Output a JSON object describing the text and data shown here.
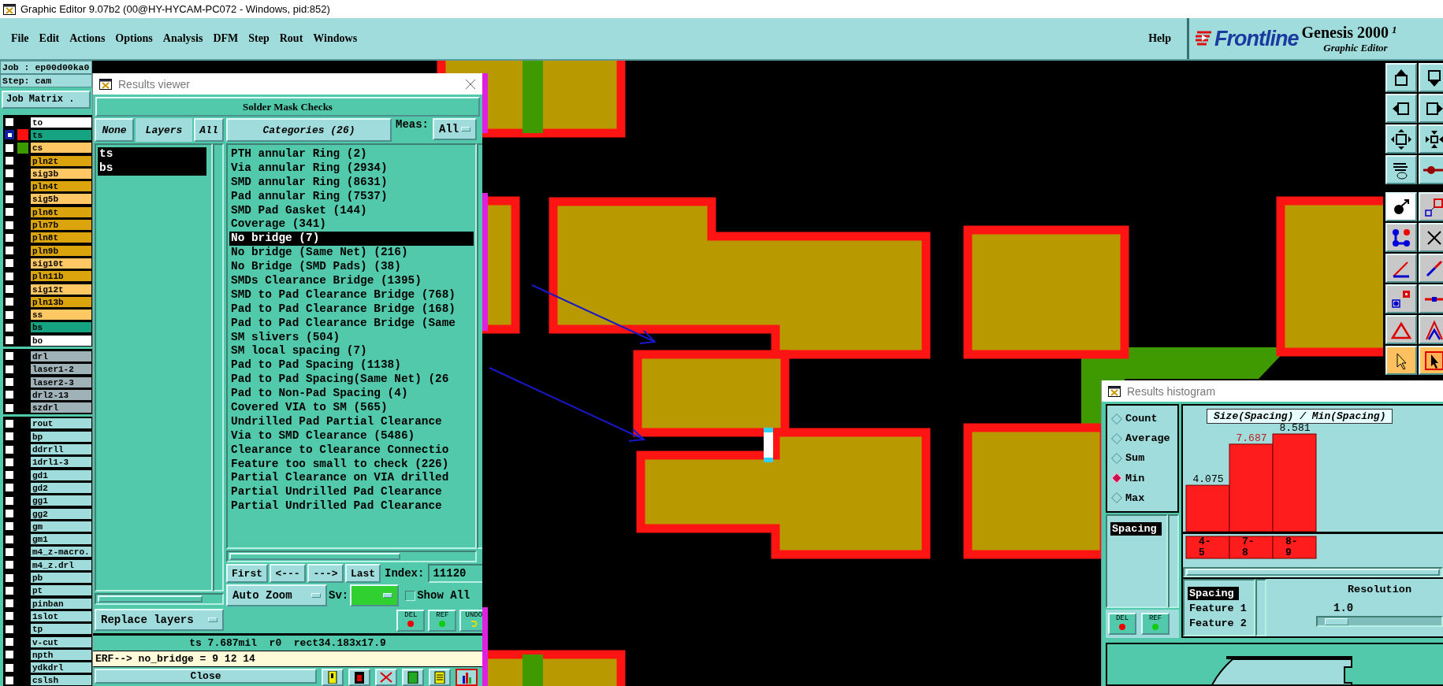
{
  "window": {
    "title": "Graphic Editor 9.07b2 (00@HY-HYCAM-PC072 - Windows, pid:852)"
  },
  "menu": [
    "File",
    "Edit",
    "Actions",
    "Options",
    "Analysis",
    "DFM",
    "Step",
    "Rout",
    "Windows"
  ],
  "help": "Help",
  "logo": {
    "brand": "Frontline",
    "product": "Genesis 2000",
    "version": "1",
    "subtitle": "Graphic Editor"
  },
  "job_panel": {
    "job": "Job : ep00d00ka0",
    "step": "Step: cam",
    "matrix_button": "Job Matrix ."
  },
  "layer_groups": [
    {
      "layers": [
        {
          "name": "to",
          "color": "#ffffff",
          "work": false
        },
        {
          "name": "ts",
          "color": "#16a382",
          "work": true,
          "swatch": {
            "color": "#ff1010"
          }
        },
        {
          "name": "cs",
          "color": "#ffc864",
          "work": false,
          "swatch": {
            "color": "#3a9a00"
          }
        },
        {
          "name": "pln2t",
          "color": "#dba40c",
          "work": false
        },
        {
          "name": "sig3b",
          "color": "#ffc864",
          "work": false
        },
        {
          "name": "pln4t",
          "color": "#dba40c",
          "work": false
        },
        {
          "name": "sig5b",
          "color": "#ffc864",
          "work": false
        },
        {
          "name": "pln6t",
          "color": "#dba40c",
          "work": false
        },
        {
          "name": "pln7b",
          "color": "#dba40c",
          "work": false
        },
        {
          "name": "pln8t",
          "color": "#dba40c",
          "work": false
        },
        {
          "name": "pln9b",
          "color": "#dba40c",
          "work": false
        },
        {
          "name": "sig10t",
          "color": "#ffc864",
          "work": false
        },
        {
          "name": "pln11b",
          "color": "#dba40c",
          "work": false
        },
        {
          "name": "sig12t",
          "color": "#ffc864",
          "work": false
        },
        {
          "name": "pln13b",
          "color": "#dba40c",
          "work": false
        },
        {
          "name": "ss",
          "color": "#ffc864",
          "work": false
        },
        {
          "name": "bs",
          "color": "#16a382",
          "work": false
        },
        {
          "name": "bo",
          "color": "#ffffff",
          "work": false
        }
      ]
    },
    {
      "layers": [
        {
          "name": "drl",
          "color": "#9fb2b8",
          "work": false
        },
        {
          "name": "laser1-2",
          "color": "#9fb2b8",
          "work": false
        },
        {
          "name": "laser2-3",
          "color": "#9fb2b8",
          "work": false
        },
        {
          "name": "drl2-13",
          "color": "#9fb2b8",
          "work": false
        },
        {
          "name": "szdrl",
          "color": "#9fb2b8",
          "work": false
        }
      ]
    },
    {
      "layers": [
        {
          "name": "rout",
          "color": "#a0dcdc",
          "work": false
        },
        {
          "name": "bp",
          "color": "#a0dcdc",
          "work": false
        },
        {
          "name": "ddrrll",
          "color": "#a0dcdc",
          "work": false
        },
        {
          "name": "1drl1-3",
          "color": "#a0dcdc",
          "work": false
        },
        {
          "name": "gd1",
          "color": "#a0dcdc",
          "work": false
        },
        {
          "name": "gd2",
          "color": "#a0dcdc",
          "work": false
        },
        {
          "name": "gg1",
          "color": "#a0dcdc",
          "work": false
        },
        {
          "name": "gg2",
          "color": "#a0dcdc",
          "work": false
        },
        {
          "name": "gm",
          "color": "#a0dcdc",
          "work": false
        },
        {
          "name": "gm1",
          "color": "#a0dcdc",
          "work": false
        },
        {
          "name": "m4_z-macro.",
          "color": "#a0dcdc",
          "work": false
        },
        {
          "name": "m4_z.drl",
          "color": "#a0dcdc",
          "work": false
        },
        {
          "name": "pb",
          "color": "#a0dcdc",
          "work": false
        },
        {
          "name": "pt",
          "color": "#a0dcdc",
          "work": false
        },
        {
          "name": "pinban",
          "color": "#a0dcdc",
          "work": false
        },
        {
          "name": "1slot",
          "color": "#a0dcdc",
          "work": false
        },
        {
          "name": "tp",
          "color": "#a0dcdc",
          "work": false
        },
        {
          "name": "v-cut",
          "color": "#a0dcdc",
          "work": false
        },
        {
          "name": "npth",
          "color": "#a0dcdc",
          "work": false
        },
        {
          "name": "ydkdrl",
          "color": "#a0dcdc",
          "work": false
        },
        {
          "name": "cslsh",
          "color": "#a0dcdc",
          "work": false
        }
      ]
    }
  ],
  "toolbar": [
    {
      "kind": "move-up",
      "selected": false
    },
    {
      "kind": "move-down",
      "selected": false
    },
    {
      "kind": "move-left",
      "selected": false
    },
    {
      "kind": "move-right",
      "selected": false
    },
    {
      "kind": "expand",
      "selected": false
    },
    {
      "kind": "shrink",
      "selected": false
    },
    {
      "kind": "tools",
      "selected": false
    },
    {
      "kind": "snap",
      "selected": false
    },
    {
      "kind": "feature-info",
      "selected": false
    },
    {
      "kind": "edit-shape",
      "selected": false
    },
    {
      "kind": "connect",
      "selected": false
    },
    {
      "kind": "cross",
      "selected": false
    },
    {
      "kind": "measure",
      "selected": false
    },
    {
      "kind": "measure-line",
      "selected": false
    },
    {
      "kind": "measure-pad",
      "selected": false
    },
    {
      "kind": "measure-center",
      "selected": false
    },
    {
      "kind": "triangle",
      "selected": false
    },
    {
      "kind": "triangle-angle",
      "selected": false
    },
    {
      "kind": "pointer",
      "selected": true
    },
    {
      "kind": "pointer-box",
      "selected": true
    }
  ],
  "results_viewer": {
    "title": "Results viewer",
    "header": "Solder Mask Checks",
    "none_button": "None",
    "layers_button": "Layers",
    "all_button": "All",
    "layers": [
      {
        "name": "ts",
        "selected": true
      },
      {
        "name": "bs",
        "selected": true
      }
    ],
    "categories_button": "Categories (26)",
    "meas_label": "Meas:",
    "meas_value": "All",
    "categories": [
      {
        "label": "PTH annular Ring (2)",
        "selected": false
      },
      {
        "label": "Via annular Ring (2934)",
        "selected": false
      },
      {
        "label": "SMD annular Ring (8631)",
        "selected": false
      },
      {
        "label": "Pad annular Ring (7537)",
        "selected": false
      },
      {
        "label": "SMD Pad Gasket (144)",
        "selected": false
      },
      {
        "label": "Coverage (341)",
        "selected": false
      },
      {
        "label": "No bridge (7)",
        "selected": true
      },
      {
        "label": "No bridge (Same Net) (216)",
        "selected": false
      },
      {
        "label": "No Bridge (SMD Pads) (38)",
        "selected": false
      },
      {
        "label": "SMDs Clearance Bridge (1395)",
        "selected": false
      },
      {
        "label": "SMD to Pad Clearance Bridge (768)",
        "selected": false
      },
      {
        "label": "Pad to Pad Clearance Bridge (168)",
        "selected": false
      },
      {
        "label": "Pad to Pad Clearance Bridge (Same",
        "selected": false
      },
      {
        "label": "SM slivers (504)",
        "selected": false
      },
      {
        "label": "SM local spacing (7)",
        "selected": false
      },
      {
        "label": "Pad to Pad Spacing (1138)",
        "selected": false
      },
      {
        "label": "Pad to Pad Spacing(Same Net) (26",
        "selected": false
      },
      {
        "label": "Pad to Non-Pad Spacing (4)",
        "selected": false
      },
      {
        "label": "Covered VIA to SM (565)",
        "selected": false
      },
      {
        "label": "Undrilled Pad Partial Clearance",
        "selected": false
      },
      {
        "label": "Via to SMD Clearance (5486)",
        "selected": false
      },
      {
        "label": "Clearance to Clearance Connectio",
        "selected": false
      },
      {
        "label": "Feature too small to check (226)",
        "selected": false
      },
      {
        "label": "Partial Clearance on VIA drilled",
        "selected": false
      },
      {
        "label": "Partial Undrilled Pad Clearance",
        "selected": false
      },
      {
        "label": "Partial Undrilled Pad Clearance",
        "selected": false
      }
    ],
    "nav": [
      "First",
      "<---",
      "--->",
      "Last"
    ],
    "index_label": "Index:",
    "index_value": "11120",
    "zoom_mode": "Auto Zoom",
    "sv_label": "Sv:",
    "show_all": {
      "label": "Show All",
      "checked": false
    },
    "replace_mode": "Replace layers",
    "edit_buttons": [
      {
        "label": "DEL",
        "kind": "delete"
      },
      {
        "label": "REF",
        "kind": "refresh"
      },
      {
        "label": "UNDO",
        "kind": "undo"
      }
    ],
    "status": "ts 7.687mil  r0  rect34.183x17.9",
    "erf": "ERF--> no_bridge = 9 12 14",
    "close": "Close"
  },
  "histogram": {
    "title": "Results histogram",
    "modes": [
      {
        "label": "Count",
        "selected": false
      },
      {
        "label": "Average",
        "selected": false
      },
      {
        "label": "Sum",
        "selected": false
      },
      {
        "label": "Min",
        "selected": true
      },
      {
        "label": "Max",
        "selected": false
      }
    ],
    "measures": [
      {
        "label": "Spacing",
        "selected": true
      }
    ],
    "buttons": [
      {
        "label": "DEL",
        "kind": "delete"
      },
      {
        "label": "REF",
        "kind": "refresh"
      }
    ],
    "chart_data": {
      "type": "bar",
      "title": "Size(Spacing) / Min(Spacing)",
      "categories": [
        "4-5",
        "7-8",
        "8-9"
      ],
      "values": [
        4.075,
        7.687,
        8.581
      ],
      "data_labels": true
    },
    "fields": [
      {
        "label": "Spacing",
        "selected": true
      },
      {
        "label": "Feature 1",
        "selected": false
      },
      {
        "label": "Feature 2",
        "selected": false
      }
    ],
    "resolution_label": "Resolution",
    "resolution_value": "1.0",
    "resolution": {
      "level": 0.06
    }
  }
}
